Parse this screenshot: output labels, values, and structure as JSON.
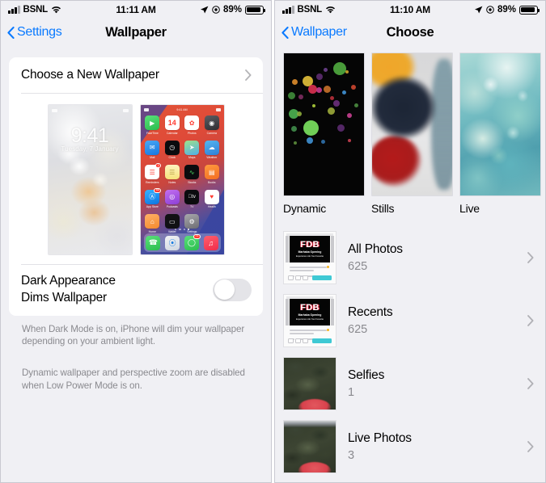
{
  "left": {
    "status": {
      "signal": "signal-bars",
      "carrier": "BSNL",
      "wifi": "wifi-icon",
      "time": "11:11 AM",
      "location": "location-arrow",
      "focus": "focus-icon",
      "battery_pct": "89%",
      "battery": "battery-icon"
    },
    "nav": {
      "back": "Settings",
      "title": "Wallpaper"
    },
    "choose_row": {
      "label": "Choose a New Wallpaper"
    },
    "preview": {
      "lock": {
        "time": "9:41",
        "date": "Tuesday, 7 January"
      },
      "home": {
        "status_time": "9:41 AM",
        "apps": [
          {
            "name": "FaceTime",
            "glyph": "▶",
            "bg": "linear-gradient(160deg,#5ae07a,#2bbd4e)",
            "badge": ""
          },
          {
            "name": "Calendar",
            "glyph": "14",
            "bg": "#ffffff",
            "badge": ""
          },
          {
            "name": "Photos",
            "glyph": "✿",
            "bg": "#ffffff",
            "badge": ""
          },
          {
            "name": "Camera",
            "glyph": "◉",
            "bg": "linear-gradient(160deg,#5d5d62,#2e2e33)",
            "badge": ""
          },
          {
            "name": "Mail",
            "glyph": "✉",
            "bg": "linear-gradient(160deg,#4aa8f5,#1777e0)",
            "badge": ""
          },
          {
            "name": "Clock",
            "glyph": "◷",
            "bg": "#0b0b0e",
            "badge": ""
          },
          {
            "name": "Maps",
            "glyph": "➤",
            "bg": "linear-gradient(160deg,#9fe08a,#4fb0e8)",
            "badge": ""
          },
          {
            "name": "Weather",
            "glyph": "☁",
            "bg": "linear-gradient(160deg,#56b6f0,#2f7fd6)",
            "badge": ""
          },
          {
            "name": "Reminders",
            "glyph": "☰",
            "bg": "#ffffff",
            "badge": "2"
          },
          {
            "name": "Notes",
            "glyph": "☰",
            "bg": "linear-gradient(180deg,#fdf3c0,#f6e27a)",
            "badge": ""
          },
          {
            "name": "Stocks",
            "glyph": "∿",
            "bg": "#0b0b0e",
            "badge": ""
          },
          {
            "name": "Books",
            "glyph": "▤",
            "bg": "linear-gradient(160deg,#ff9b3f,#f36d22)",
            "badge": ""
          },
          {
            "name": "App Store",
            "glyph": "Ⓐ",
            "bg": "linear-gradient(160deg,#38b3ff,#0b74e0)",
            "badge": "68"
          },
          {
            "name": "Podcasts",
            "glyph": "◎",
            "bg": "linear-gradient(160deg,#c36ff0,#8c3fd6)",
            "badge": ""
          },
          {
            "name": "TV",
            "glyph": "tv",
            "bg": "#0b0b0e",
            "badge": ""
          },
          {
            "name": "Health",
            "glyph": "♥",
            "bg": "#ffffff",
            "badge": ""
          },
          {
            "name": "Home",
            "glyph": "⌂",
            "bg": "linear-gradient(160deg,#ffb066,#f58a2e)",
            "badge": ""
          },
          {
            "name": "Wallet",
            "glyph": "▭",
            "bg": "#111114",
            "badge": ""
          },
          {
            "name": "Settings",
            "glyph": "⚙",
            "bg": "linear-gradient(160deg,#a8a8ad,#6d6d73)",
            "badge": ""
          }
        ],
        "dock": [
          {
            "name": "Phone",
            "glyph": "☎",
            "bg": "linear-gradient(160deg,#5ae07a,#2bbd4e)",
            "badge": ""
          },
          {
            "name": "Safari",
            "glyph": "⦿",
            "bg": "linear-gradient(160deg,#f2f3f5,#cfd6e0)",
            "badge": ""
          },
          {
            "name": "Messages",
            "glyph": "◯",
            "bg": "linear-gradient(160deg,#5ae07a,#2bbd4e)",
            "badge": "71"
          },
          {
            "name": "Music",
            "glyph": "♫",
            "bg": "linear-gradient(160deg,#ff5f6d,#f02c4a)",
            "badge": ""
          }
        ],
        "page_dots": 4,
        "active_dot": 4
      }
    },
    "dark_row": {
      "line1": "Dark Appearance",
      "line2": "Dims Wallpaper",
      "toggle_state": "off"
    },
    "footnote1": "When Dark Mode is on, iPhone will dim your wallpaper depending on your ambient light.",
    "footnote2": "Dynamic wallpaper and perspective zoom are disabled when Low Power Mode is on."
  },
  "right": {
    "status": {
      "signal": "signal-bars",
      "carrier": "BSNL",
      "wifi": "wifi-icon",
      "time": "11:10 AM",
      "location": "location-arrow",
      "focus": "focus-icon",
      "battery_pct": "89%",
      "battery": "battery-icon"
    },
    "nav": {
      "back": "Wallpaper",
      "title": "Choose"
    },
    "categories": [
      {
        "name": "Dynamic",
        "style": "dynamic"
      },
      {
        "name": "Stills",
        "style": "stills"
      },
      {
        "name": "Live",
        "style": "live"
      }
    ],
    "albums": [
      {
        "title": "All Photos",
        "count": "625",
        "thumb": "screenshot-fdb"
      },
      {
        "title": "Recents",
        "count": "625",
        "thumb": "screenshot-fdb"
      },
      {
        "title": "Selfies",
        "count": "1",
        "thumb": "foliage"
      },
      {
        "title": "Live Photos",
        "count": "3",
        "thumb": "foliage-topbar"
      }
    ]
  },
  "colors": {
    "accent": "#0a7aff",
    "background": "#f0f0f4",
    "card": "#ffffff",
    "secondary_text": "#8a8a8f"
  }
}
